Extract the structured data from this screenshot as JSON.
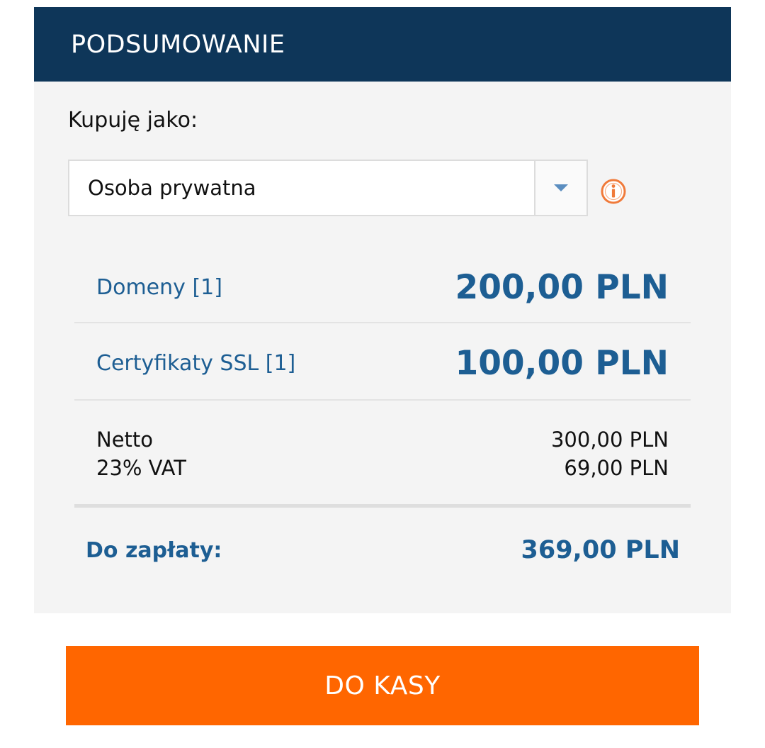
{
  "header": {
    "title": "PODSUMOWANIE"
  },
  "buyer": {
    "label": "Kupuję jako:",
    "selected": "Osoba prywatna"
  },
  "items": [
    {
      "label": "Domeny [1]",
      "price": "200,00 PLN"
    },
    {
      "label": "Certyfikaty SSL [1]",
      "price": "100,00 PLN"
    }
  ],
  "totals": {
    "net_label": "Netto",
    "net_value": "300,00 PLN",
    "vat_label": "23% VAT",
    "vat_value": "69,00 PLN",
    "due_label": "Do zapłaty:",
    "due_value": "369,00 PLN"
  },
  "checkout": {
    "label": "DO KASY"
  },
  "colors": {
    "header_bg": "#0e3659",
    "accent_blue": "#1d5e93",
    "cta_orange": "#ff6600",
    "info_orange": "#f07a3a"
  },
  "icons": {
    "dropdown": "chevron-down-icon",
    "info": "info-icon"
  }
}
